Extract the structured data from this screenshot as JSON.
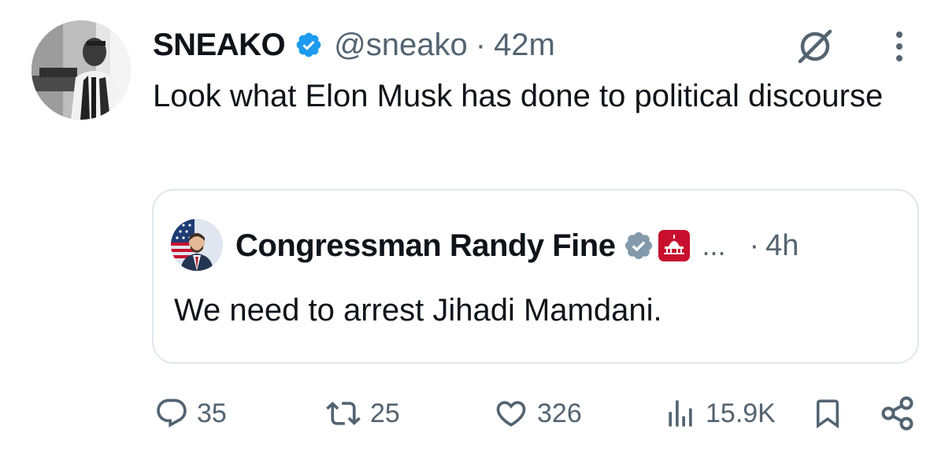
{
  "tweet": {
    "author_name": "SNEAKO",
    "handle": "@sneako",
    "separator": "·",
    "time": "42m",
    "text": "Look what Elon Musk has done to political discourse"
  },
  "quoted_tweet": {
    "author_name": "Congressman Randy Fine",
    "affiliation_badge_text": "HOUSE GOP",
    "ellipsis": "...",
    "separator": "·",
    "time": "4h",
    "text": "We need to arrest Jihadi Mamdani."
  },
  "actions": {
    "replies": "35",
    "reposts": "25",
    "likes": "326",
    "views": "15.9K"
  },
  "icons": {
    "verified": "verified-badge-icon",
    "grok": "grok-icon",
    "more": "more-vertical-icon",
    "reply": "reply-icon",
    "repost": "repost-icon",
    "like": "heart-icon",
    "views": "views-icon",
    "bookmark": "bookmark-icon",
    "share": "share-icon"
  },
  "colors": {
    "verified_blue": "#1d9bf0",
    "affiliation_gray": "#829aab",
    "text_primary": "#0f1419",
    "text_secondary": "#536471",
    "border": "#e1e6ea",
    "gop_red": "#c8102e"
  }
}
